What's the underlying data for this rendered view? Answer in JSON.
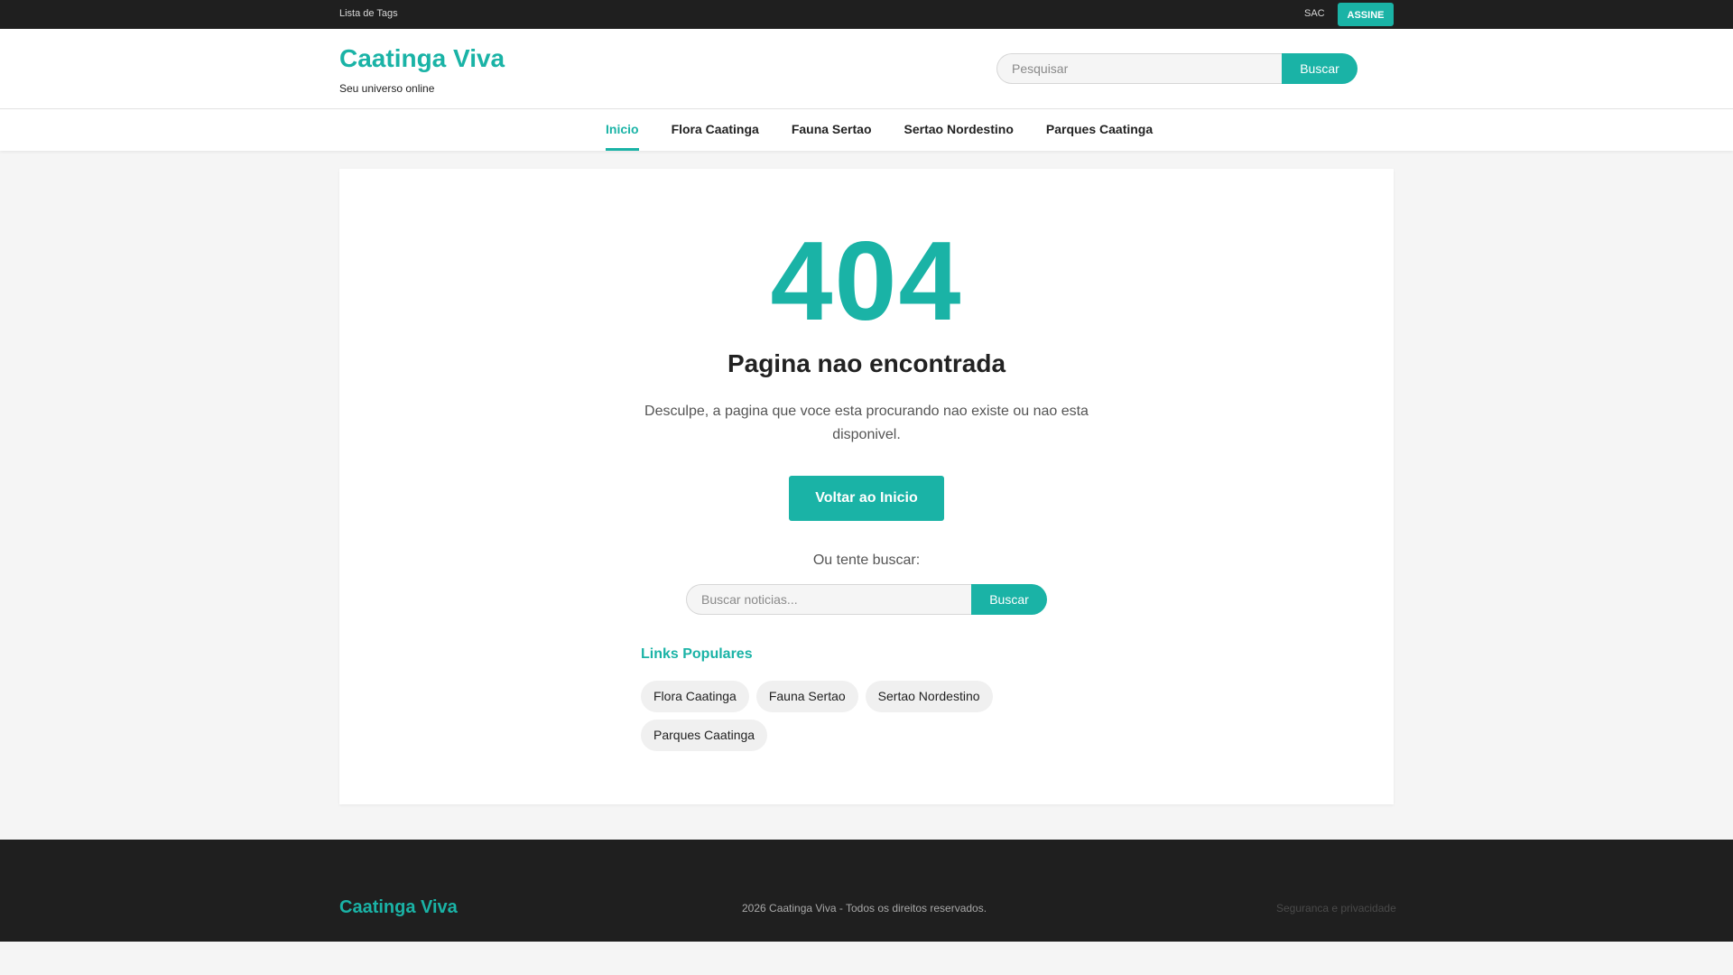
{
  "topbar": {
    "tags_link": "Lista de Tags",
    "sac_link": "SAC",
    "subscribe_button": "ASSINE"
  },
  "header": {
    "brand": "Caatinga Viva",
    "tagline": "Seu universo online",
    "search": {
      "placeholder": "Pesquisar",
      "value": "",
      "button": "Buscar"
    }
  },
  "nav": {
    "items": [
      {
        "label": "Inicio",
        "active": true
      },
      {
        "label": "Flora Caatinga",
        "active": false
      },
      {
        "label": "Fauna Sertao",
        "active": false
      },
      {
        "label": "Sertao Nordestino",
        "active": false
      },
      {
        "label": "Parques Caatinga",
        "active": false
      }
    ]
  },
  "error": {
    "code": "404",
    "title": "Pagina nao encontrada",
    "description": "Desculpe, a pagina que voce esta procurando nao existe ou nao esta disponivel.",
    "back_button": "Voltar ao Inicio",
    "try_search": "Ou tente buscar:",
    "search": {
      "placeholder": "Buscar noticias...",
      "value": "",
      "button": "Buscar"
    },
    "popular_title": "Links Populares",
    "popular_links": [
      "Flora Caatinga",
      "Fauna Sertao",
      "Sertao Nordestino",
      "Parques Caatinga"
    ]
  },
  "footer": {
    "brand": "Caatinga Viva",
    "copyright": "2026 Caatinga Viva - Todos os direitos reservados.",
    "privacy_link": "Seguranca e privacidade"
  },
  "colors": {
    "accent": "#1ab3a6",
    "dark": "#1f1f1f",
    "background": "#f5f5f5"
  }
}
